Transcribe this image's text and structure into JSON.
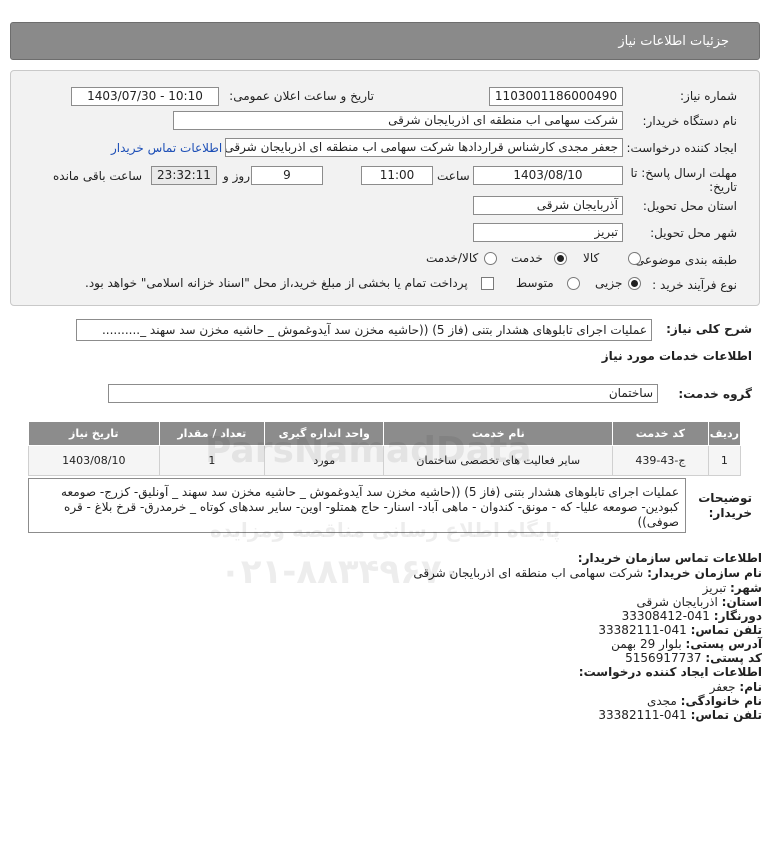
{
  "header": {
    "title": "جزئیات اطلاعات نیاز"
  },
  "form": {
    "need_number_label": "شماره نیاز:",
    "need_number": "1103001186000490",
    "announce_label": "تاریخ و ساعت اعلان عمومی:",
    "announce_value": "1403/07/30 - 10:10",
    "buyer_label": "نام دستگاه خریدار:",
    "buyer_value": "شرکت سهامی اب منطقه ای اذربایجان شرقی",
    "creator_label": "ایجاد کننده درخواست:",
    "creator_value": "جعفر مجدی کارشناس قراردادها شرکت سهامی اب منطقه ای اذربایجان شرقی",
    "contact_link": "اطلاعات تماس خریدار",
    "deadline_label_1": "مهلت ارسال پاسخ: تا",
    "deadline_label_2": "تاریخ:",
    "deadline_date": "1403/08/10",
    "time_label": "ساعت",
    "deadline_time": "11:00",
    "days_value": "9",
    "days_label": "روز و",
    "remaining_time": "23:32:11",
    "remaining_label": "ساعت باقی مانده",
    "province_label": "استان محل تحویل:",
    "province_value": "آذربایجان شرقی",
    "city_label": "شهر محل تحویل:",
    "city_value": "تبریز",
    "category_label": "طبقه بندی موضوعی:",
    "category_options": [
      "کالا",
      "خدمت",
      "کالا/خدمت"
    ],
    "category_selected": "خدمت",
    "process_label": "نوع فرآیند خرید :",
    "process_options": [
      "جزیی",
      "متوسط"
    ],
    "process_selected": "جزیی",
    "payment_text": "پرداخت تمام یا بخشی از مبلغ خرید،از محل \"اسناد خزانه اسلامی\" خواهد بود."
  },
  "summary": {
    "label": "شرح کلی نیاز:",
    "value": "عملیات اجرای تابلوهای هشدار بتنی (فاز 5) ((حاشیه مخزن سد آیدوغموش _ حاشیه مخزن سد سهند _.........."
  },
  "services_section": {
    "title": "اطلاعات خدمات مورد نیاز",
    "group_label": "گروه خدمت:",
    "group_value": "ساختمان"
  },
  "table": {
    "headers": [
      "ردیف",
      "کد خدمت",
      "نام خدمت",
      "واحد اندازه گیری",
      "تعداد / مقدار",
      "تاریخ نیاز"
    ],
    "rows": [
      [
        "1",
        "ج-43-439",
        "سایر فعالیت های تخصصی ساختمان",
        "مورد",
        "1",
        "1403/08/10"
      ]
    ]
  },
  "buyer_notes": {
    "label_1": "توضیحات",
    "label_2": "خریدار:",
    "text": "عملیات اجرای تابلوهای هشدار بتنی (فاز 5) ((حاشیه مخزن سد آیدوغموش _ حاشیه مخزن سد سهند _ آونلیق- کزرج- صومعه کبودین- صومعه علیا- که - مونق- کندوان - ماهی آباد- اسنار- حاج همتلو- اوین- سایر سدهای کوتاه _ خرمدرق- قرخ بلاغ - قره صوفی))"
  },
  "contact": {
    "title": "اطلاعات تماس سازمان خریدار:",
    "org_label": "نام سازمان خریدار:",
    "org_value": "شرکت سهامی اب منطقه ای اذربایجان شرقی",
    "city_label": "شهر:",
    "city_value": "تبریز",
    "province_label": "استان:",
    "province_value": "اذربایجان شرقی",
    "fax_label": "دورنگار:",
    "fax_value": "041-33308412",
    "phone_label": "تلفن تماس:",
    "phone_value": "041-33382111",
    "address_label": "آدرس پستی:",
    "address_value": "بلوار 29 بهمن",
    "postal_label": "کد پستی:",
    "postal_value": "5156917737",
    "creator_title": "اطلاعات ایجاد کننده درخواست:",
    "name_label": "نام:",
    "name_value": "جعفر",
    "family_label": "نام خانوادگی:",
    "family_value": "مجدی",
    "creator_phone_label": "تلفن تماس:",
    "creator_phone_value": "041-33382111"
  },
  "watermark": {
    "brand": "ParsNamadData",
    "slogan": "پایگاه اطلاع رسانی مناقصه ومزایده",
    "phone": "۰۲۱-۸۸۳۴۹۶۷۰"
  }
}
